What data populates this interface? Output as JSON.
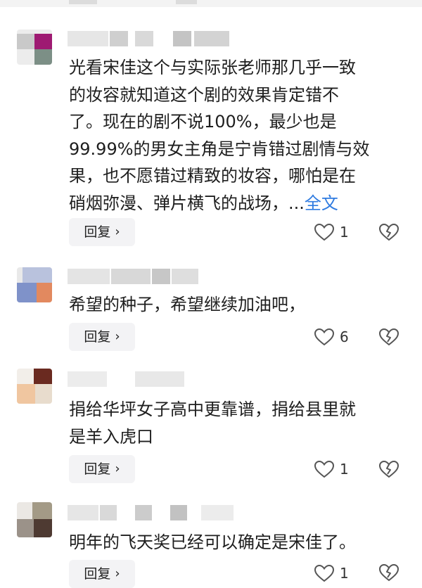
{
  "reply_label": "回复",
  "reply_chevron": "›",
  "comments": [
    {
      "text_lines": [
        "光看宋佳这个与实际张老师那几乎一致",
        "的妆容就知道这个剧的效果肯定错不",
        "了。现在的剧不说100%，最少也是",
        "99.99%的男女主角是宁肯错过剧情与效",
        "果，也不愿错过精致的妆容，哪怕是在",
        "硝烟弥漫、弹片横飞的战场，..."
      ],
      "more_link": "全文",
      "likes": "1"
    },
    {
      "text_lines": [
        "希望的种子，希望继续加油吧，"
      ],
      "likes": "6"
    },
    {
      "text_lines": [
        "捐给华坪女子高中更靠谱，捐给县里就",
        "是羊入虎口"
      ],
      "likes": "1"
    },
    {
      "text_lines": [
        "明年的飞天奖已经可以确定是宋佳了。"
      ],
      "likes": "1"
    }
  ],
  "colors": {
    "link": "#2f7be0",
    "reply_bg": "#f3f3f5",
    "icon_stroke": "#555555"
  },
  "icons": {
    "like": "heart-outline-icon",
    "dislike": "broken-heart-icon"
  }
}
